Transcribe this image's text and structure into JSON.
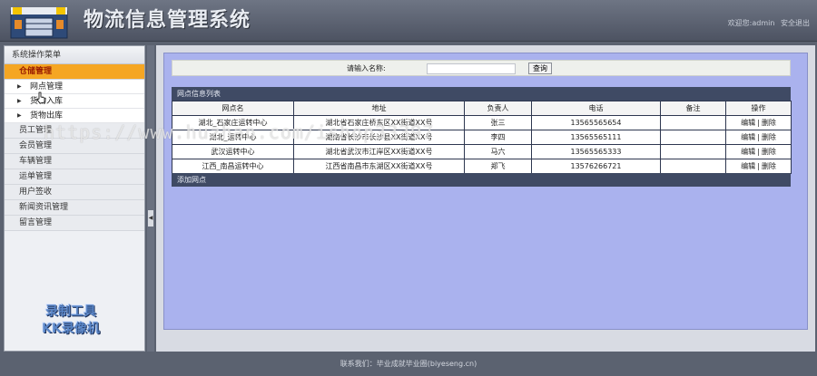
{
  "header": {
    "title": "物流信息管理系统",
    "welcome": "欢迎您:admin",
    "logout": "安全退出"
  },
  "sidebar": {
    "heading": "系统操作菜单",
    "groups": [
      {
        "label": "仓储管理",
        "active": true
      },
      {
        "label": "员工管理"
      },
      {
        "label": "会员管理"
      },
      {
        "label": "车辆管理"
      },
      {
        "label": "运单管理"
      },
      {
        "label": "用户签收"
      },
      {
        "label": "新闻资讯管理"
      },
      {
        "label": "留言管理"
      }
    ],
    "subitems": [
      {
        "label": "网点管理"
      },
      {
        "label": "货物入库"
      },
      {
        "label": "货物出库"
      }
    ],
    "watermark": [
      "录制工具",
      "KK录像机"
    ]
  },
  "search": {
    "label": "请输入名称:",
    "value": "",
    "button": "查询"
  },
  "list": {
    "title": "网点信息列表",
    "columns": [
      "网点名",
      "地址",
      "负责人",
      "电话",
      "备注",
      "操作"
    ],
    "rows": [
      {
        "name": "湖北_石家庄运转中心",
        "address": "湖北省石家庄桥东区XX街道XX号",
        "manager": "张三",
        "phone": "13565565654",
        "remark": ""
      },
      {
        "name": "湖北_运转中心",
        "address": "湖南省长沙市长沙县XX街道XX号",
        "manager": "李四",
        "phone": "13565565111",
        "remark": ""
      },
      {
        "name": "武汉运转中心",
        "address": "湖北省武汉市江岸区XX街道XX号",
        "manager": "马六",
        "phone": "13565565333",
        "remark": ""
      },
      {
        "name": "江西_南昌运转中心",
        "address": "江西省南昌市东湖区XX街道XX号",
        "manager": "郑飞",
        "phone": "13576266721",
        "remark": ""
      }
    ],
    "edit_label": "编辑",
    "sep": "|",
    "delete_label": "删除",
    "add_label": "添加网点"
  },
  "footer": {
    "text": "联系我们：毕业成就毕业圈(biyeseng.cn)"
  },
  "overlay": {
    "url": "https://www.huzhan.com/ishop33397"
  },
  "colors": {
    "header_bg": "#5b6270",
    "active_menu": "#f5a623",
    "panel_bg": "#aab2ee",
    "table_title_bg": "#3f4a64"
  }
}
